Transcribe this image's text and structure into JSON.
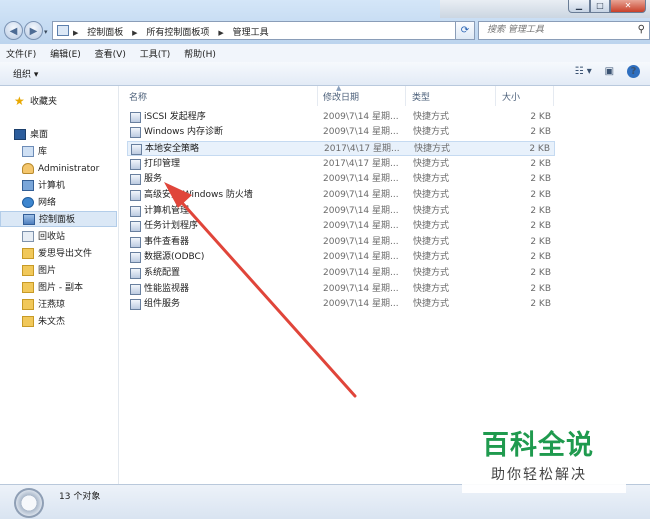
{
  "address": {
    "crumbs": [
      "控制面板",
      "所有控制面板项",
      "管理工具"
    ],
    "search_placeholder": "搜索 管理工具"
  },
  "menu": [
    "文件(F)",
    "编辑(E)",
    "查看(V)",
    "工具(T)",
    "帮助(H)"
  ],
  "toolbar": {
    "organize": "组织 ▾"
  },
  "nav": {
    "favorites": "收藏夹",
    "desktop": "桌面",
    "library": "库",
    "user": "Administrator",
    "computer": "计算机",
    "network": "网络",
    "control_panel": "控制面板",
    "recycle_bin": "回收站",
    "folders": [
      "爱思导出文件",
      "图片",
      "图片 - 副本",
      "汪燕琼",
      "朱文杰"
    ]
  },
  "columns": {
    "name": "名称",
    "date": "修改日期",
    "type": "类型",
    "size": "大小"
  },
  "files": [
    {
      "name": "iSCSI 发起程序",
      "date": "2009\\7\\14 星期...",
      "type": "快捷方式",
      "size": "2 KB"
    },
    {
      "name": "Windows 内存诊断",
      "date": "2009\\7\\14 星期...",
      "type": "快捷方式",
      "size": "2 KB"
    },
    {
      "name": "本地安全策略",
      "date": "2017\\4\\17 星期...",
      "type": "快捷方式",
      "size": "2 KB"
    },
    {
      "name": "打印管理",
      "date": "2017\\4\\17 星期...",
      "type": "快捷方式",
      "size": "2 KB"
    },
    {
      "name": "服务",
      "date": "2009\\7\\14 星期...",
      "type": "快捷方式",
      "size": "2 KB"
    },
    {
      "name": "高级安全 Windows 防火墙",
      "date": "2009\\7\\14 星期...",
      "type": "快捷方式",
      "size": "2 KB"
    },
    {
      "name": "计算机管理",
      "date": "2009\\7\\14 星期...",
      "type": "快捷方式",
      "size": "2 KB"
    },
    {
      "name": "任务计划程序",
      "date": "2009\\7\\14 星期...",
      "type": "快捷方式",
      "size": "2 KB"
    },
    {
      "name": "事件查看器",
      "date": "2009\\7\\14 星期...",
      "type": "快捷方式",
      "size": "2 KB"
    },
    {
      "name": "数据源(ODBC)",
      "date": "2009\\7\\14 星期...",
      "type": "快捷方式",
      "size": "2 KB"
    },
    {
      "name": "系统配置",
      "date": "2009\\7\\14 星期...",
      "type": "快捷方式",
      "size": "2 KB"
    },
    {
      "name": "性能监视器",
      "date": "2009\\7\\14 星期...",
      "type": "快捷方式",
      "size": "2 KB"
    },
    {
      "name": "组件服务",
      "date": "2009\\7\\14 星期...",
      "type": "快捷方式",
      "size": "2 KB"
    }
  ],
  "status": {
    "count": "13 个对象"
  },
  "watermark": {
    "title": "百科全说",
    "subtitle": "助你轻松解决"
  },
  "colors": {
    "arrow": "#e0453a",
    "watermark_green": "#1f9a4e",
    "selection": "#dbe8f6"
  }
}
